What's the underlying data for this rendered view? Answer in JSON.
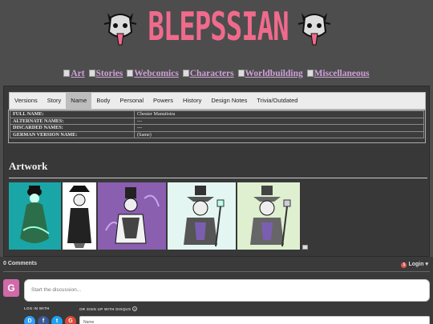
{
  "site": {
    "logo_text": "BLEPSSIAN"
  },
  "nav": [
    {
      "label": "Art"
    },
    {
      "label": "Stories"
    },
    {
      "label": "Webcomics"
    },
    {
      "label": "Characters"
    },
    {
      "label": "Worldbuilding"
    },
    {
      "label": "Miscellaneous"
    }
  ],
  "tabs": [
    {
      "label": "Versions",
      "active": false
    },
    {
      "label": "Story",
      "active": false
    },
    {
      "label": "Name",
      "active": true
    },
    {
      "label": "Body",
      "active": false
    },
    {
      "label": "Personal",
      "active": false
    },
    {
      "label": "Powers",
      "active": false
    },
    {
      "label": "History",
      "active": false
    },
    {
      "label": "Design Notes",
      "active": false
    },
    {
      "label": "Trivia/Outdated",
      "active": false
    }
  ],
  "info_table": [
    {
      "key": "FULL NAME:",
      "value": "Chester Manutistra"
    },
    {
      "key": "ALTERNATE NAMES:",
      "value": "---"
    },
    {
      "key": "DISCARDED NAMES:",
      "value": "---"
    },
    {
      "key": "GERMAN VERSION NAME:",
      "value": "(Same)"
    }
  ],
  "artwork": {
    "title": "Artwork"
  },
  "comments": {
    "count_label": "0 Comments",
    "login_label": "Login",
    "login_badge": "1",
    "avatar_letter": "G",
    "discuss_placeholder": "Start the discussion...",
    "log_in_with": "LOG IN WITH",
    "sign_up_with": "OR SIGN UP WITH DISQUS",
    "help_mark": "?",
    "name_placeholder": "Name",
    "social": [
      {
        "letter": "D",
        "color": "#2e9fff"
      },
      {
        "letter": "f",
        "color": "#3b5998"
      },
      {
        "letter": "t",
        "color": "#1da1f2"
      },
      {
        "letter": "G",
        "color": "#dd4b39"
      }
    ]
  },
  "colors": {
    "background": "#4d4d4d",
    "logo": "#f06a8c",
    "nav_link": "#cfa0d8"
  }
}
